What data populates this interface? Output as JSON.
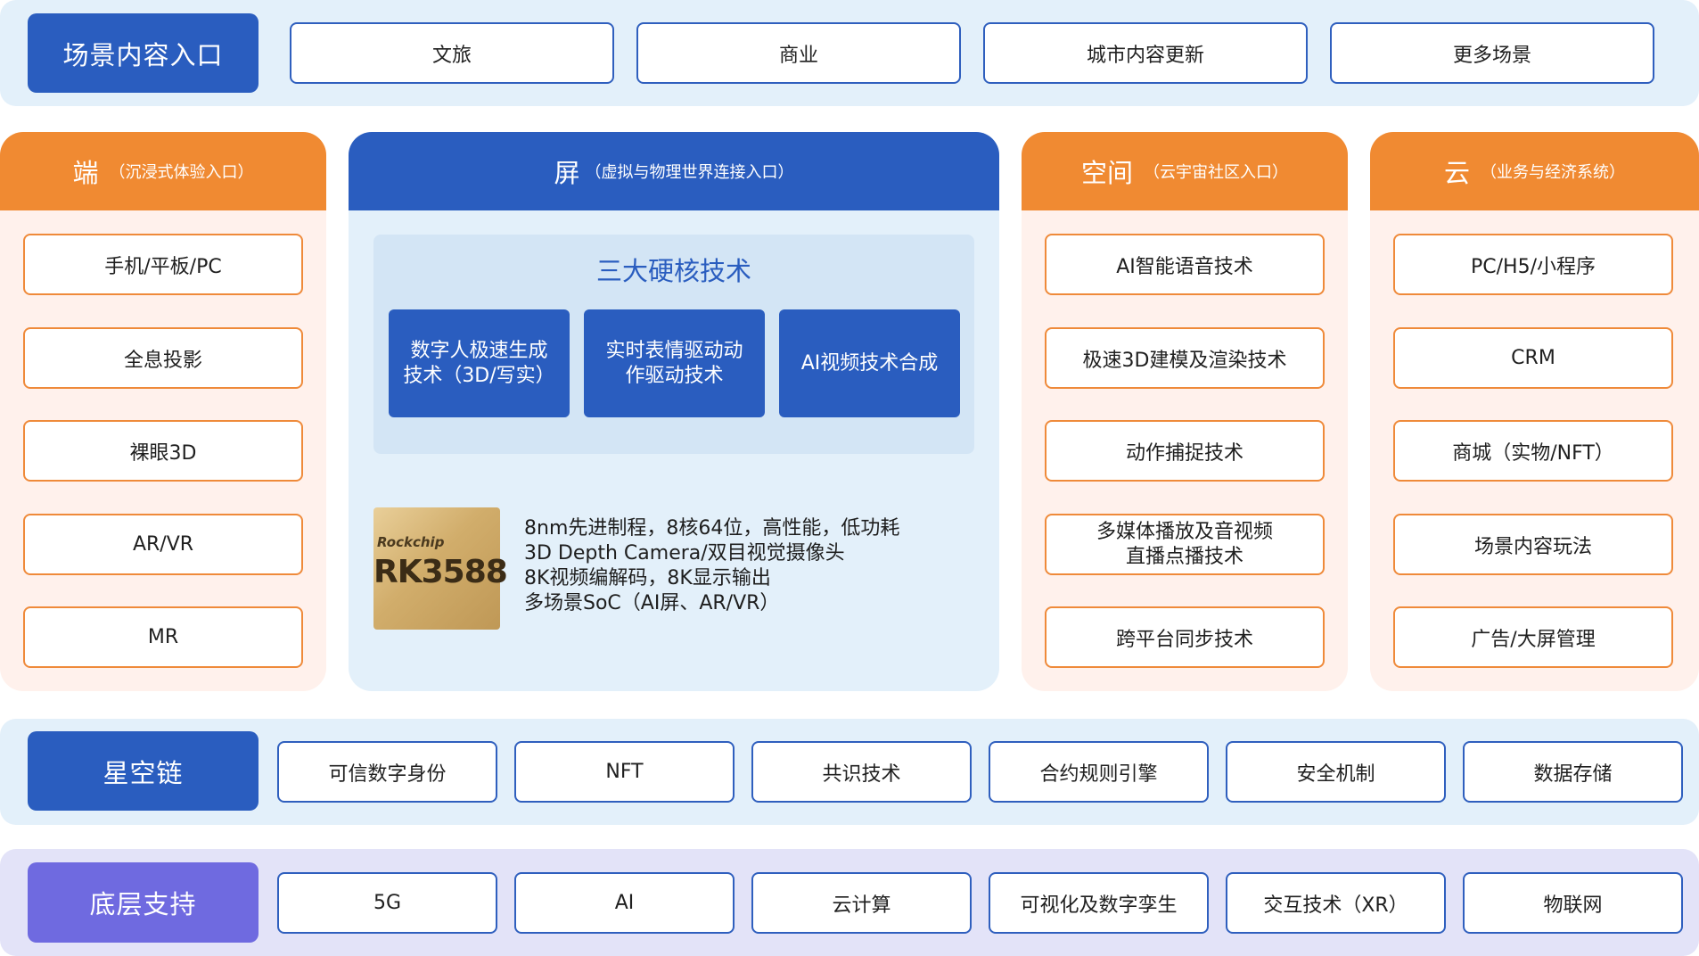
{
  "scene": {
    "label": "场景内容入口",
    "items": [
      "文旅",
      "商业",
      "城市内容更新",
      "更多场景"
    ]
  },
  "columns": {
    "duan": {
      "title": "端",
      "subtitle": "（沉浸式体验入口）",
      "items": [
        "手机/平板/PC",
        "全息投影",
        "裸眼3D",
        "AR/VR",
        "MR"
      ]
    },
    "ping": {
      "title": "屏",
      "subtitle": "（虚拟与物理世界连接入口）",
      "tech_title": "三大硬核技术",
      "techs": [
        [
          "数字人极速生成",
          "技术（3D/写实）"
        ],
        [
          "实时表情驱动动",
          "作驱动技术"
        ],
        [
          "AI视频技术合成"
        ]
      ],
      "chip": {
        "brand": "Rockchip",
        "model": "RK3588"
      },
      "specs": [
        "8nm先进制程，8核64位，高性能，低功耗",
        "3D Depth Camera/双目视觉摄像头",
        "8K视频编解码，8K显示输出",
        "多场景SoC（AI屏、AR/VR）"
      ]
    },
    "kongjian": {
      "title": "空间",
      "subtitle": "（云宇宙社区入口）",
      "items": [
        [
          "AI智能语音技术"
        ],
        [
          "极速3D建模及渲染技术"
        ],
        [
          "动作捕捉技术"
        ],
        [
          "多媒体播放及音视频",
          "直播点播技术"
        ],
        [
          "跨平台同步技术"
        ]
      ]
    },
    "yun": {
      "title": "云",
      "subtitle": "（业务与经济系统）",
      "items": [
        "PC/H5/小程序",
        "CRM",
        "商城（实物/NFT）",
        "场景内容玩法",
        "广告/大屏管理"
      ]
    }
  },
  "chain": {
    "label": "星空链",
    "items": [
      "可信数字身份",
      "NFT",
      "共识技术",
      "合约规则引擎",
      "安全机制",
      "数据存储"
    ]
  },
  "base": {
    "label": "底层支持",
    "items": [
      "5G",
      "AI",
      "云计算",
      "可视化及数字孪生",
      "交互技术（XR）",
      "物联网"
    ]
  },
  "colors": {
    "blue": "#2a5dbf",
    "orange": "#f08a32",
    "purple": "#6f6ae0",
    "light_blue_bg": "#e3f0fa",
    "light_orange_bg": "#fff1ec",
    "light_purple_bg": "#e3e3f8"
  }
}
